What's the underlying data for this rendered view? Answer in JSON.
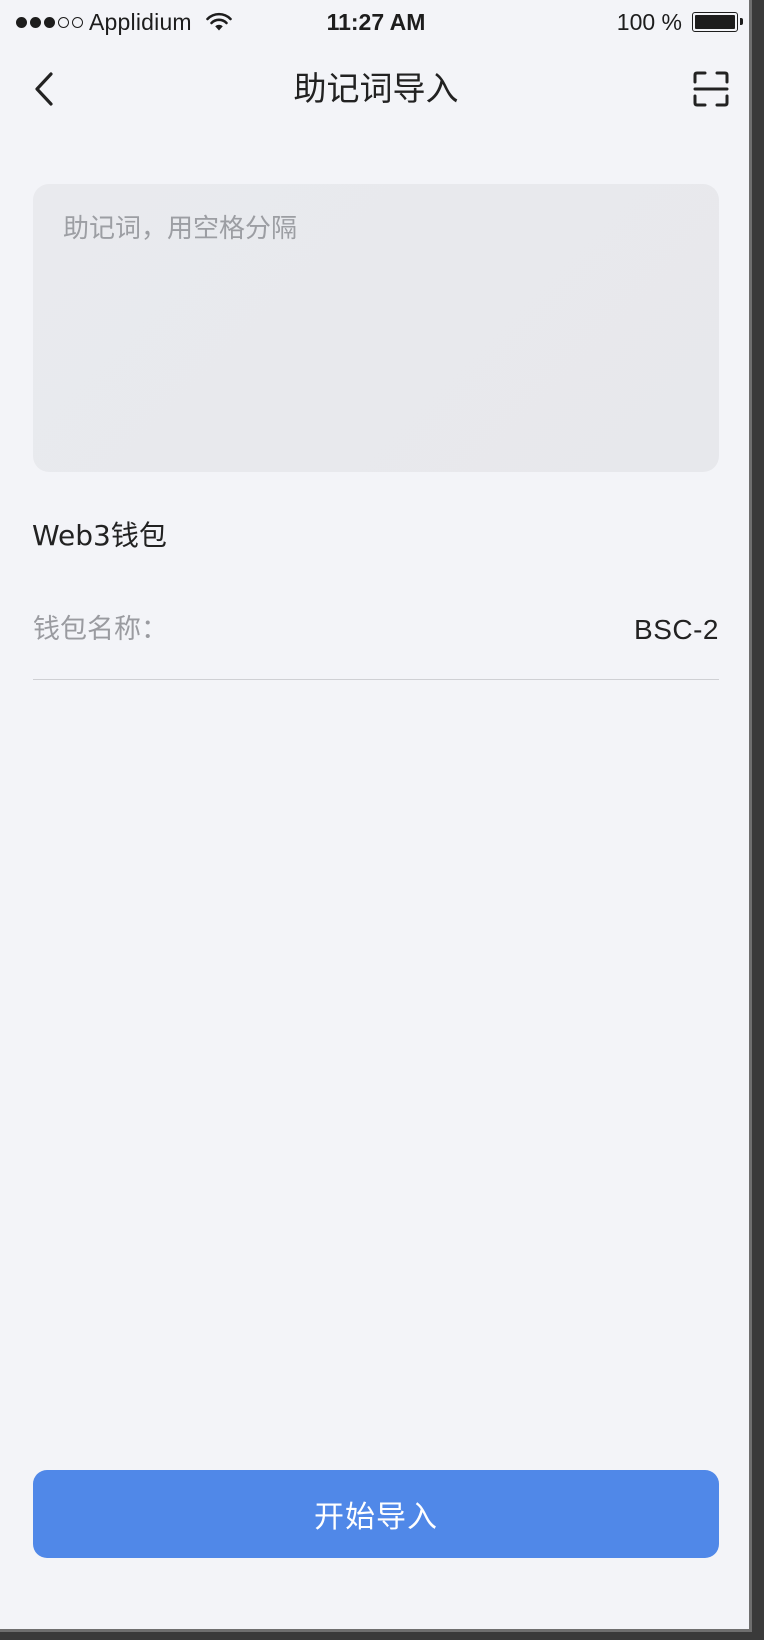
{
  "status_bar": {
    "carrier": "Applidium",
    "time": "11:27 AM",
    "battery": "100 %",
    "signal_bars_filled": 3,
    "signal_bars_total": 5
  },
  "nav": {
    "title": "助记词导入",
    "back_icon": "chevron-left-icon",
    "scan_icon": "scan-icon"
  },
  "mnemonic": {
    "placeholder": "助记词，用空格分隔",
    "value": ""
  },
  "section": {
    "title": "Web3钱包"
  },
  "wallet_name": {
    "label": "钱包名称：",
    "value": "BSC-2"
  },
  "actions": {
    "import_label": "开始导入"
  },
  "colors": {
    "background": "#f3f4f8",
    "accent": "#5088e8",
    "input_bg": "#e9eaee"
  }
}
